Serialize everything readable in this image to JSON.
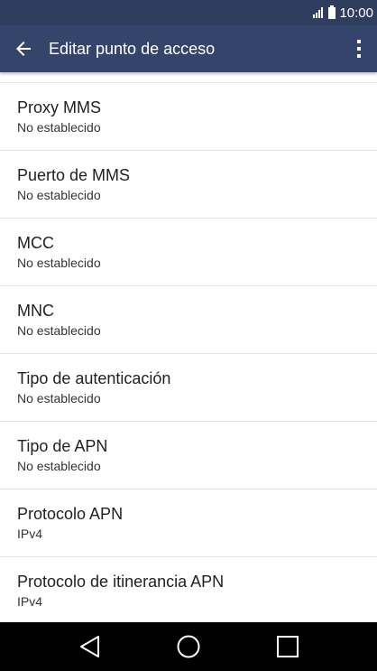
{
  "status_bar": {
    "time": "10:00",
    "icons": [
      "signal-icon",
      "battery-icon"
    ]
  },
  "app_bar": {
    "title": "Editar punto de acceso",
    "back_icon": "arrow-left-icon",
    "menu_icon": "more-vert-icon"
  },
  "settings": [
    {
      "title": "Proxy MMS",
      "summary": "No establecido"
    },
    {
      "title": "Puerto de MMS",
      "summary": "No establecido"
    },
    {
      "title": "MCC",
      "summary": "No establecido"
    },
    {
      "title": "MNC",
      "summary": "No establecido"
    },
    {
      "title": "Tipo de autenticación",
      "summary": "No establecido"
    },
    {
      "title": "Tipo de APN",
      "summary": "No establecido"
    },
    {
      "title": "Protocolo APN",
      "summary": "IPv4"
    },
    {
      "title": "Protocolo de itinerancia APN",
      "summary": "IPv4"
    }
  ],
  "nav_bar": {
    "buttons": [
      "back-triangle-icon",
      "home-circle-icon",
      "recents-square-icon"
    ]
  },
  "colors": {
    "status_bar": "#2f3d5f",
    "app_bar": "#34446a",
    "divider": "#e2e2e2",
    "nav_bar": "#000000"
  }
}
